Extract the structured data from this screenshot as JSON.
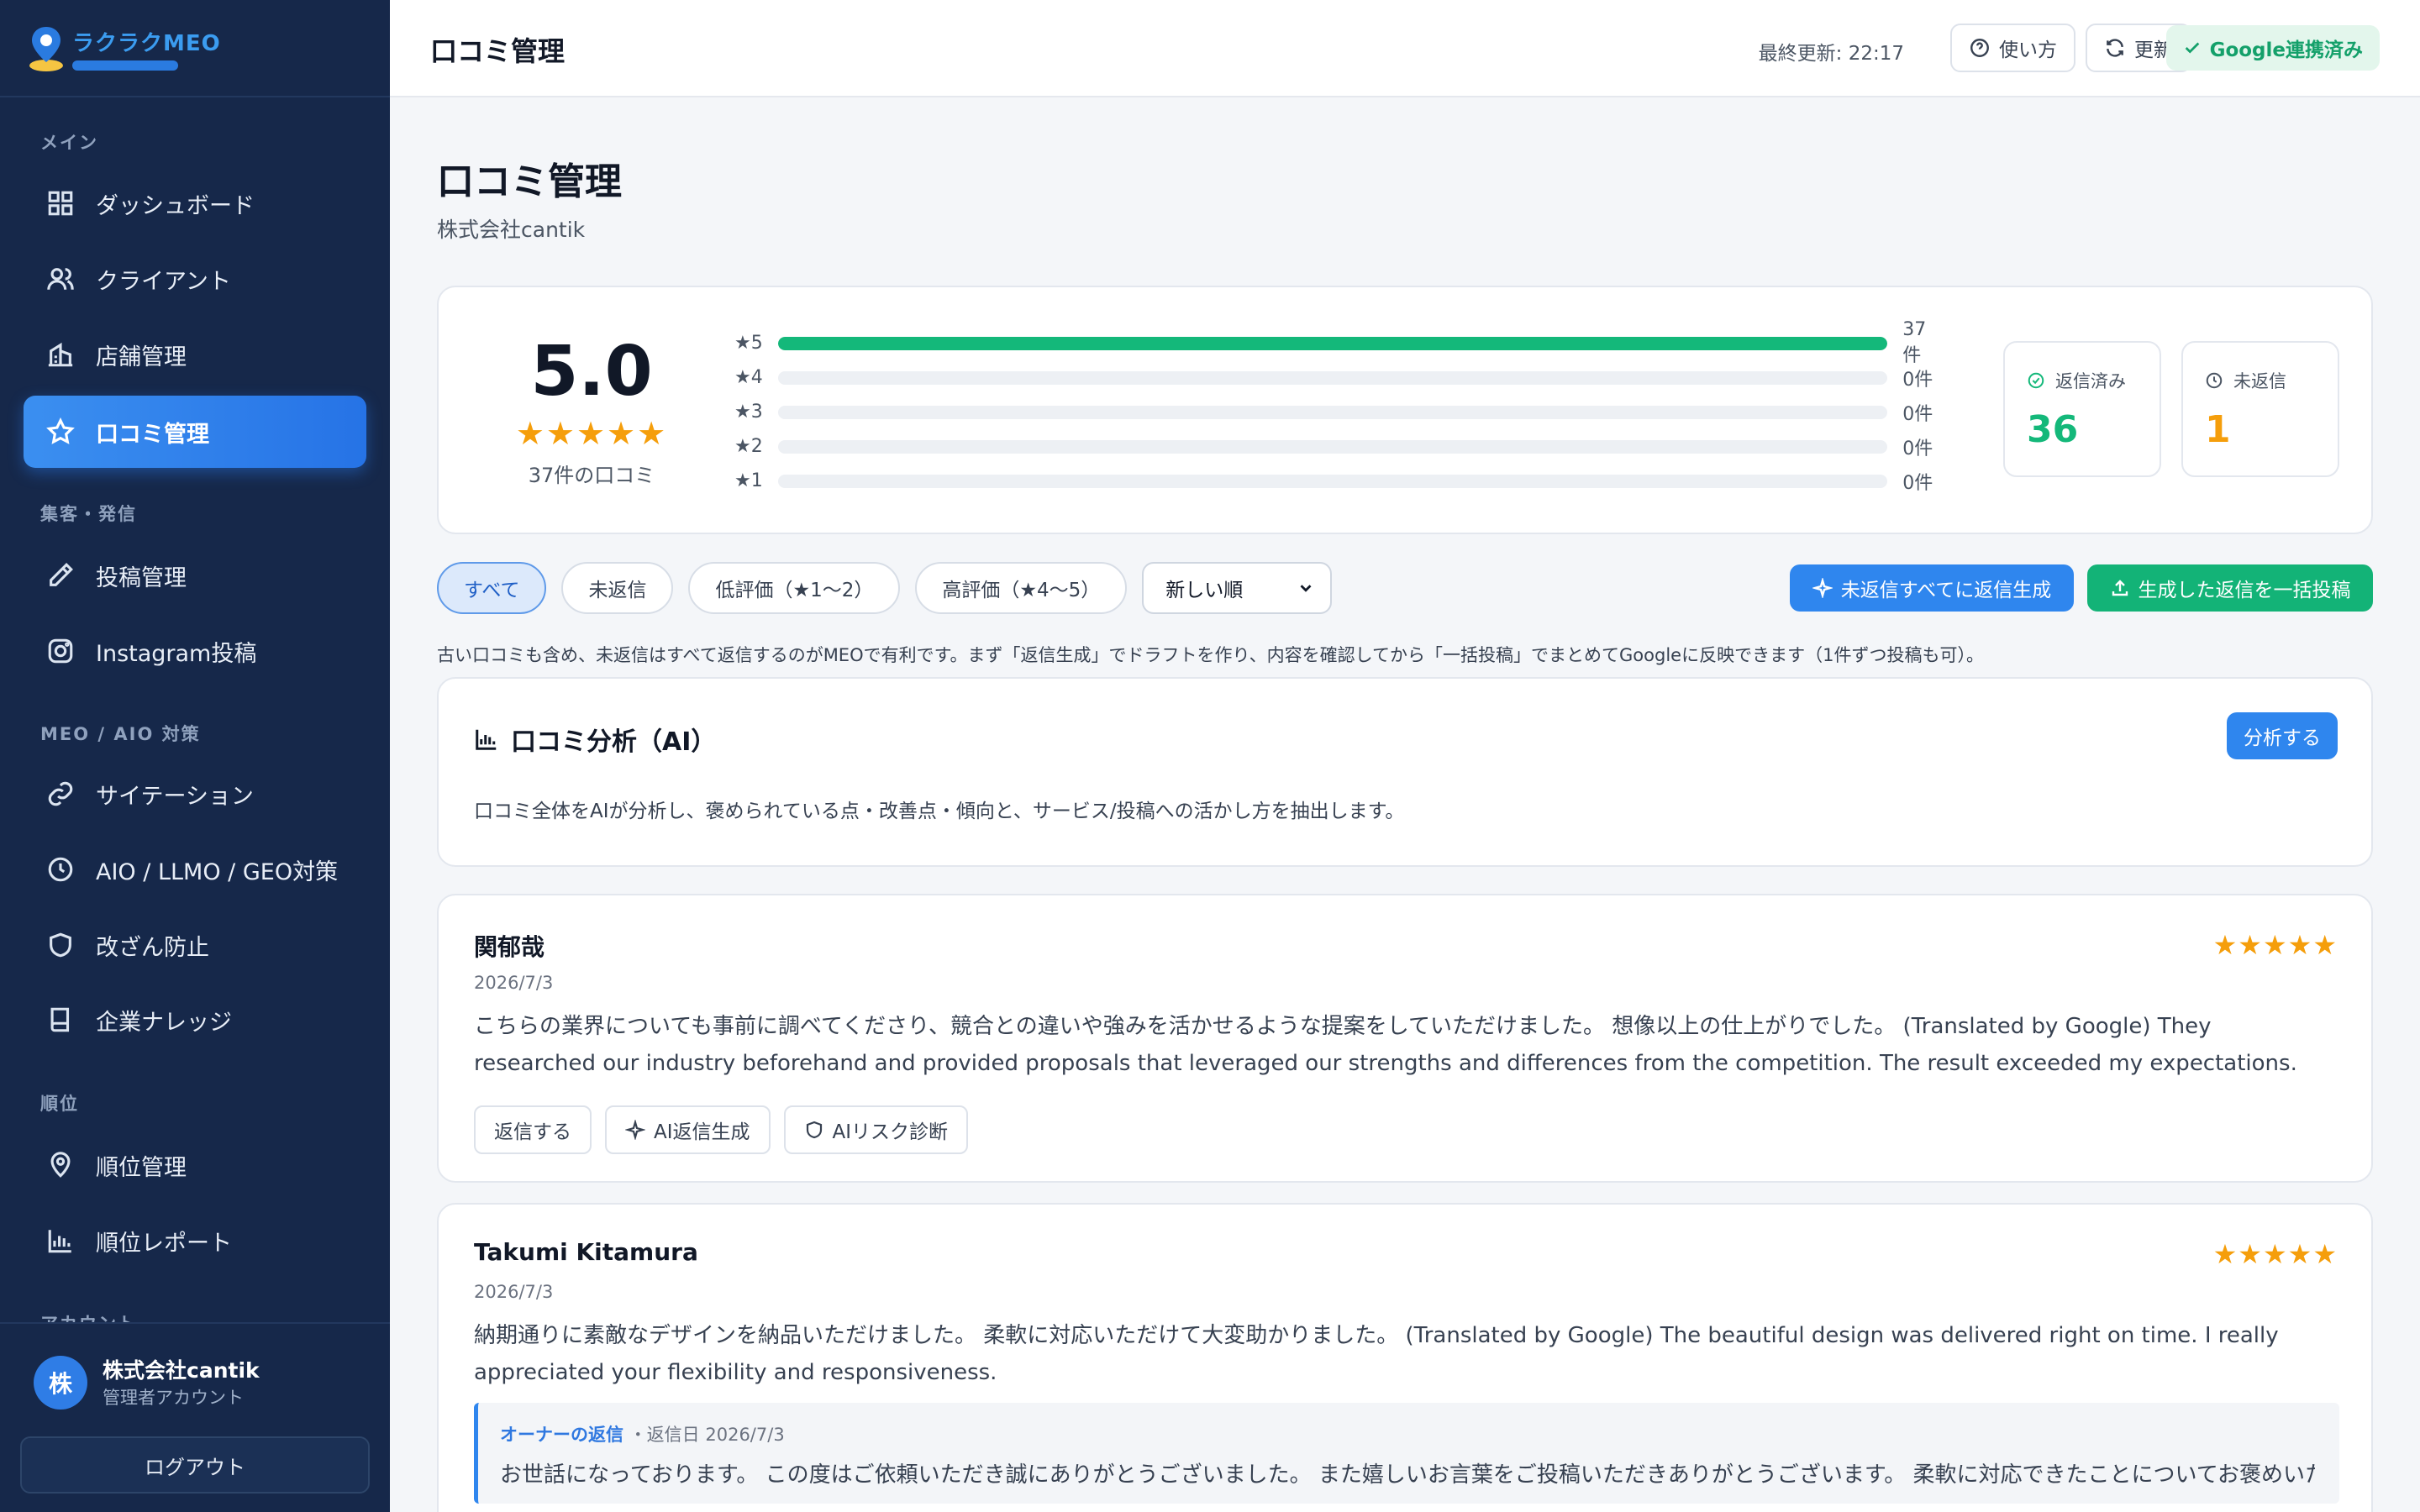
{
  "app": {
    "logo_text": "ラクラクMEO"
  },
  "sidebar": {
    "sections": [
      {
        "label": "メイン"
      },
      {
        "label": "集客・発信"
      },
      {
        "label": "MEO / AIO 対策"
      },
      {
        "label": "順位"
      },
      {
        "label": "アカウント"
      }
    ],
    "items": [
      {
        "label": "ダッシュボード",
        "icon": "grid-icon"
      },
      {
        "label": "クライアント",
        "icon": "users-icon"
      },
      {
        "label": "店舗管理",
        "icon": "building-icon"
      },
      {
        "label": "口コミ管理",
        "icon": "star-icon",
        "active": true
      },
      {
        "label": "投稿管理",
        "icon": "pencil-icon"
      },
      {
        "label": "Instagram投稿",
        "icon": "instagram-icon"
      },
      {
        "label": "サイテーション",
        "icon": "link-icon"
      },
      {
        "label": "AIO / LLMO / GEO対策",
        "icon": "clock-icon"
      },
      {
        "label": "改ざん防止",
        "icon": "shield-icon"
      },
      {
        "label": "企業ナレッジ",
        "icon": "book-icon"
      },
      {
        "label": "順位管理",
        "icon": "map-pin-icon"
      },
      {
        "label": "順位レポート",
        "icon": "bar-chart-icon"
      }
    ],
    "account": {
      "avatar": "株",
      "name": "株式会社cantik",
      "role": "管理者アカウント",
      "logout": "ログアウト"
    }
  },
  "topbar": {
    "title": "口コミ管理",
    "last_updated": "最終更新: 22:17",
    "help": "使い方",
    "refresh": "更新",
    "google_status": "Google連携済み"
  },
  "page": {
    "title": "口コミ管理",
    "subtitle": "株式会社cantik"
  },
  "summary": {
    "average": "5.0",
    "stars": "★★★★★",
    "total": "37件の口コミ",
    "distribution": [
      {
        "label": "★5",
        "count": "37件",
        "ratio": 1.0
      },
      {
        "label": "★4",
        "count": "0件",
        "ratio": 0
      },
      {
        "label": "★3",
        "count": "0件",
        "ratio": 0
      },
      {
        "label": "★2",
        "count": "0件",
        "ratio": 0
      },
      {
        "label": "★1",
        "count": "0件",
        "ratio": 0
      }
    ],
    "replied": {
      "label": "返信済み",
      "value": "36",
      "color": "#14b87a"
    },
    "unreplied": {
      "label": "未返信",
      "value": "1",
      "color": "#f59e0b"
    }
  },
  "filters": {
    "chips": [
      "すべて",
      "未返信",
      "低評価（★1〜2）",
      "高評価（★4〜5）"
    ],
    "active": 0,
    "sort": "新しい順",
    "generate_all": "未返信すべてに返信生成",
    "bulk_post": "生成した返信を一括投稿",
    "hint": "古い口コミも含め、未返信はすべて返信するのがMEOで有利です。まず「返信生成」でドラフトを作り、内容を確認してから「一括投稿」でまとめてGoogleに反映できます（1件ずつ投稿も可）。"
  },
  "analysis": {
    "title": "口コミ分析（AI）",
    "description": "口コミ全体をAIが分析し、褒められている点・改善点・傾向と、サービス/投稿への活かし方を抽出します。",
    "button": "分析する"
  },
  "reviews": [
    {
      "name": "関郁哉",
      "date": "2026/7/3",
      "stars": "★★★★★",
      "text": "こちらの業界についても事前に調べてくださり、競合との違いや強みを活かせるような提案をしていただけました。 想像以上の仕上がりでした。 (Translated by Google) They researched our industry beforehand and provided proposals that leveraged our strengths and differences from the competition. The result exceeded my expectations.",
      "actions": [
        "返信する",
        "AI返信生成",
        "AIリスク診断"
      ]
    },
    {
      "name": "Takumi Kitamura",
      "date": "2026/7/3",
      "stars": "★★★★★",
      "text": "納期通りに素敵なデザインを納品いただけました。 柔軟に対応いただけて大変助かりました。 (Translated by Google) The beautiful design was delivered right on time. I really appreciated your flexibility and responsiveness.",
      "reply": {
        "owner_label": "オーナーの返信",
        "date": "・返信日 2026/7/3",
        "text": "お世話になっております。 この度はご依頼いただき誠にありがとうございました。 また嬉しいお言葉をご投稿いただきありがとうございます。 柔軟に対応できたことについてお褒めいただき、ご満足いただけたようで大変嬉しく思います。今後もデザインにご満足いただけるようなページ制作を提供できるよう努めてまいります。今後ともよろしくお願いいたします。"
      }
    }
  ]
}
